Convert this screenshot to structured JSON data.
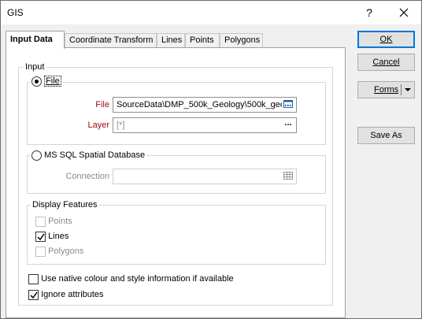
{
  "window": {
    "title": "GIS",
    "help_label": "?"
  },
  "tabs": [
    {
      "label": "Input Data",
      "active": true
    },
    {
      "label": "Coordinate Transform"
    },
    {
      "label": "Lines"
    },
    {
      "label": "Points"
    },
    {
      "label": "Polygons"
    }
  ],
  "input": {
    "group_title": "Input",
    "file_radio": {
      "label": "File",
      "selected": true
    },
    "file_field": {
      "label": "File",
      "value": "SourceData\\DMP_500k_Geology\\500k_geo"
    },
    "layer_field": {
      "label": "Layer",
      "value": "[*]",
      "button": "..."
    },
    "sql_radio": {
      "label": "MS SQL Spatial Database",
      "selected": false
    },
    "connection_field": {
      "label": "Connection",
      "value": ""
    }
  },
  "display_features": {
    "group_title": "Display Features",
    "points": {
      "label": "Points",
      "checked": false,
      "enabled": false
    },
    "lines": {
      "label": "Lines",
      "checked": true,
      "enabled": true
    },
    "polygons": {
      "label": "Polygons",
      "checked": false,
      "enabled": false
    }
  },
  "options": {
    "native_colour": {
      "label": "Use native colour and style information if available",
      "checked": false
    },
    "ignore_attributes": {
      "label": "Ignore attributes",
      "checked": true
    }
  },
  "buttons": {
    "ok": "OK",
    "cancel": "Cancel",
    "forms": "Forms",
    "save_as": "Save As"
  },
  "colors": {
    "required_label": "#a10f0f",
    "default_button_border": "#0078d7"
  }
}
